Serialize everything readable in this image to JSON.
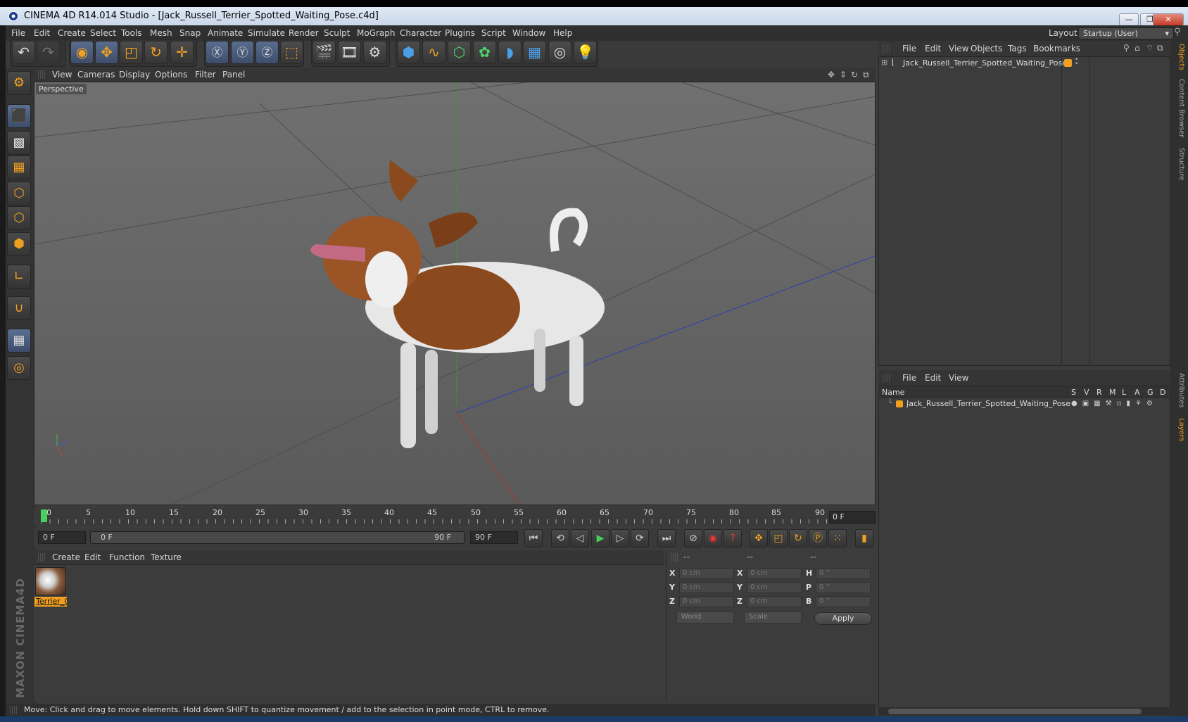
{
  "window": {
    "title": "CINEMA 4D R14.014 Studio - [Jack_Russell_Terrier_Spotted_Waiting_Pose.c4d]",
    "buttons": {
      "minimize": "—",
      "maximize": "❐",
      "close": "✕"
    }
  },
  "menubar": {
    "items": [
      "File",
      "Edit",
      "Create",
      "Select",
      "Tools",
      "Mesh",
      "Snap",
      "Animate",
      "Simulate",
      "Render",
      "Sculpt",
      "MoGraph",
      "Character",
      "Plugins",
      "Script",
      "Window",
      "Help"
    ],
    "layout_label": "Layout:",
    "layout_value": "Startup (User)"
  },
  "viewport": {
    "menu": [
      "View",
      "Cameras",
      "Display",
      "Options",
      "Filter",
      "Panel"
    ],
    "label": "Perspective"
  },
  "timeline": {
    "ticks": [
      "0",
      "5",
      "10",
      "15",
      "20",
      "25",
      "30",
      "35",
      "40",
      "45",
      "50",
      "55",
      "60",
      "65",
      "70",
      "75",
      "80",
      "85",
      "90"
    ],
    "current_frame": "0 F",
    "start_field": "0 F",
    "range_start": "0 F",
    "range_end": "90 F",
    "end_field": "90 F"
  },
  "material_panel": {
    "menu": [
      "Create",
      "Edit",
      "Function",
      "Texture"
    ],
    "material_name": "Terrier_C"
  },
  "coordinates": {
    "headers": [
      "--",
      "--",
      "--"
    ],
    "rows": [
      {
        "l1": "X",
        "v1": "0 cm",
        "l2": "X",
        "v2": "0 cm",
        "l3": "H",
        "v3": "0 °"
      },
      {
        "l1": "Y",
        "v1": "0 cm",
        "l2": "Y",
        "v2": "0 cm",
        "l3": "P",
        "v3": "0 °"
      },
      {
        "l1": "Z",
        "v1": "0 cm",
        "l2": "Z",
        "v2": "0 cm",
        "l3": "B",
        "v3": "0 °"
      }
    ],
    "space_select": "World",
    "mode_select": "Scale",
    "apply_label": "Apply"
  },
  "object_manager": {
    "menu": [
      "File",
      "Edit",
      "View",
      "Objects",
      "Tags",
      "Bookmarks"
    ],
    "object_name": "Jack_Russell_Terrier_Spotted_Waiting_Pose"
  },
  "layer_manager": {
    "menu": [
      "File",
      "Edit",
      "View"
    ],
    "columns": [
      "Name",
      "S",
      "V",
      "R",
      "M",
      "L",
      "A",
      "G",
      "D"
    ],
    "layer_name": "Jack_Russell_Terrier_Spotted_Waiting_Pose"
  },
  "right_tabs": [
    "Objects",
    "Content Browser",
    "Structure",
    "Attributes",
    "Layers"
  ],
  "status": {
    "text": "Move: Click and drag to move elements. Hold down SHIFT to quantize movement / add to the selection in point mode, CTRL to remove."
  },
  "logo": {
    "text": "MAXON CINEMA4D"
  },
  "colors": {
    "accent": "#f0a020",
    "panel": "#3c3c3c",
    "viewport": "#666666"
  }
}
